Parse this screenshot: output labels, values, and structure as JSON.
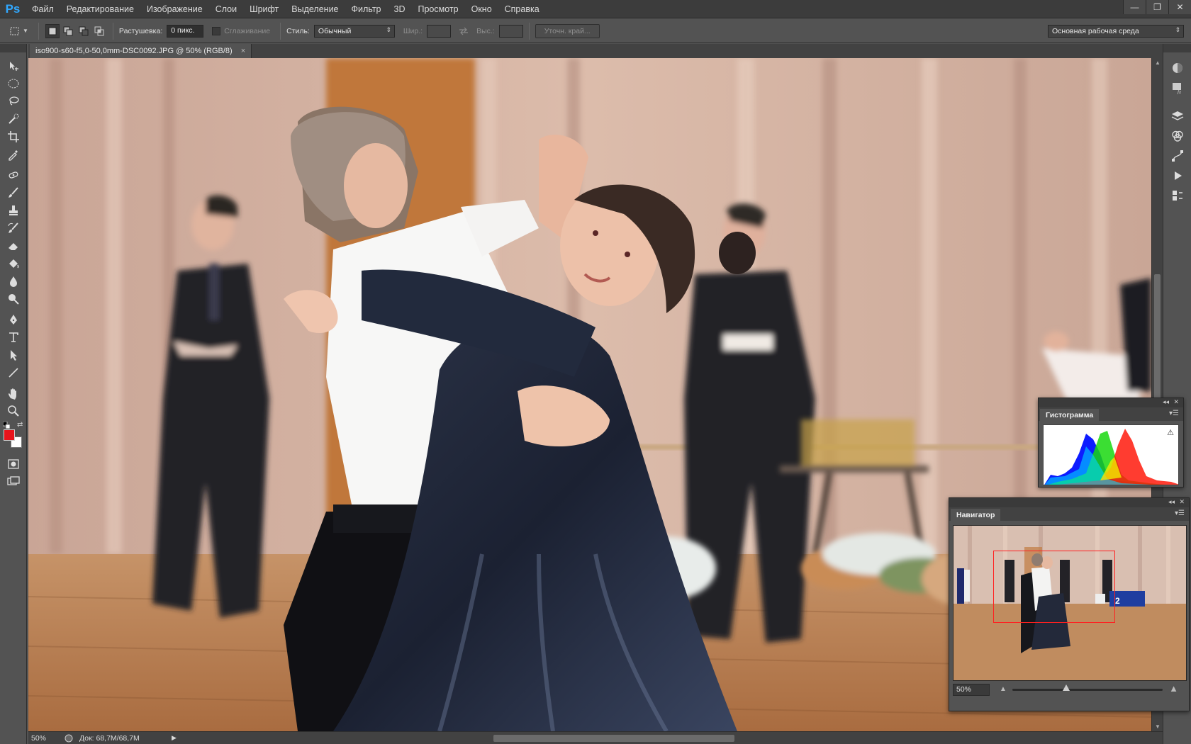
{
  "app": {
    "logo": "Ps",
    "menu": [
      "Файл",
      "Редактирование",
      "Изображение",
      "Слои",
      "Шрифт",
      "Выделение",
      "Фильтр",
      "3D",
      "Просмотр",
      "Окно",
      "Справка"
    ],
    "window_controls": [
      "—",
      "❐",
      "✕"
    ]
  },
  "options": {
    "feather_label": "Растушевка:",
    "feather_value": "0 пикс.",
    "antialias_label": "Сглаживание",
    "style_label": "Стиль:",
    "style_value": "Обычный",
    "width_label": "Шир.:",
    "height_label": "Выс.:",
    "refine_edge": "Уточн. край...",
    "workspace": "Основная рабочая среда"
  },
  "document": {
    "tab_title": "iso900-s60-f5,0-50,0mm-DSC0092.JPG @ 50% (RGB/8)",
    "tab_close": "×"
  },
  "status": {
    "zoom": "50%",
    "doc_size": "Док: 68,7M/68,7M",
    "arrow": "▶"
  },
  "colors": {
    "foreground": "#e8141c",
    "background": "#ffffff"
  },
  "panels": {
    "histogram": {
      "title": "Гистограмма",
      "warning": "⚠"
    },
    "navigator": {
      "title": "Навигатор",
      "zoom": "50%"
    }
  },
  "icons": {
    "tools": [
      "move-icon",
      "marquee-icon",
      "lasso-icon",
      "quick-selection-icon",
      "crop-icon",
      "eyedropper-icon",
      "spot-healing-icon",
      "brush-icon",
      "clone-stamp-icon",
      "history-brush-icon",
      "eraser-icon",
      "paint-bucket-icon",
      "blur-icon",
      "dodge-icon",
      "pen-icon",
      "type-icon",
      "path-selection-icon",
      "line-icon",
      "hand-icon",
      "zoom-icon"
    ],
    "dock": [
      "navigator-dock-icon",
      "styles-dock-icon",
      "layers-dock-icon",
      "channels-dock-icon",
      "paths-dock-icon",
      "actions-dock-icon",
      "history-dock-icon"
    ]
  }
}
